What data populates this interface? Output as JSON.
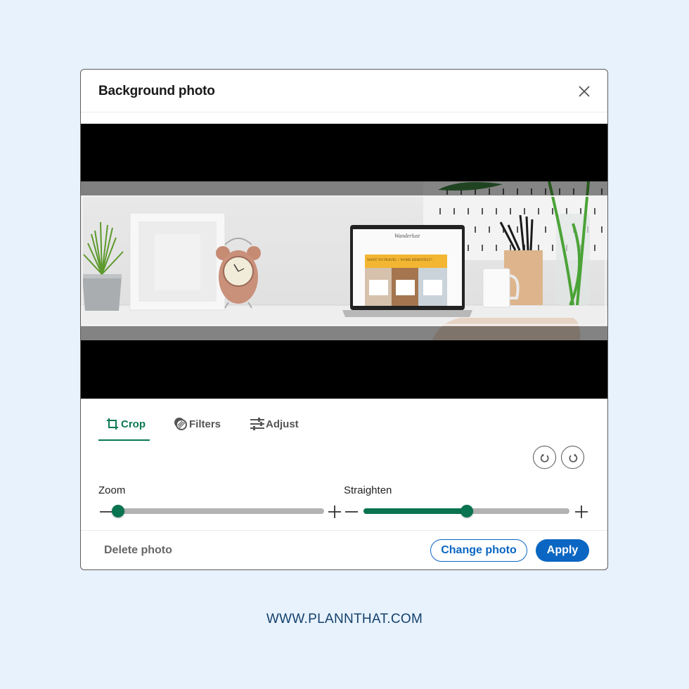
{
  "dialog": {
    "title": "Background photo",
    "close_icon": "close-icon"
  },
  "photo": {
    "description": "Desk scene with plant, picture frame, alarm clock, laptop showing Wanderlust website, pencil holder, mug and vase",
    "laptop_screen_text": {
      "site_name": "Wanderlust",
      "banner": "WANT TO TRAVEL + WORK REMOTELY?"
    }
  },
  "tabs": [
    {
      "label": "Crop",
      "icon": "crop-icon",
      "active": true
    },
    {
      "label": "Filters",
      "icon": "filters-icon",
      "active": false
    },
    {
      "label": "Adjust",
      "icon": "adjust-sliders-icon",
      "active": false
    }
  ],
  "rotate": {
    "left_icon": "rotate-counterclockwise-icon",
    "right_icon": "rotate-clockwise-icon"
  },
  "sliders": {
    "zoom": {
      "label": "Zoom",
      "value_fraction": 0.0
    },
    "straighten": {
      "label": "Straighten",
      "value_fraction": 0.5
    }
  },
  "footer": {
    "delete_label": "Delete photo",
    "change_label": "Change photo",
    "apply_label": "Apply"
  },
  "colors": {
    "accent_green": "#0a7350",
    "primary_blue": "#0a66c2",
    "page_background": "#e7f2fd"
  },
  "watermark": "WWW.PLANNTHAT.COM"
}
